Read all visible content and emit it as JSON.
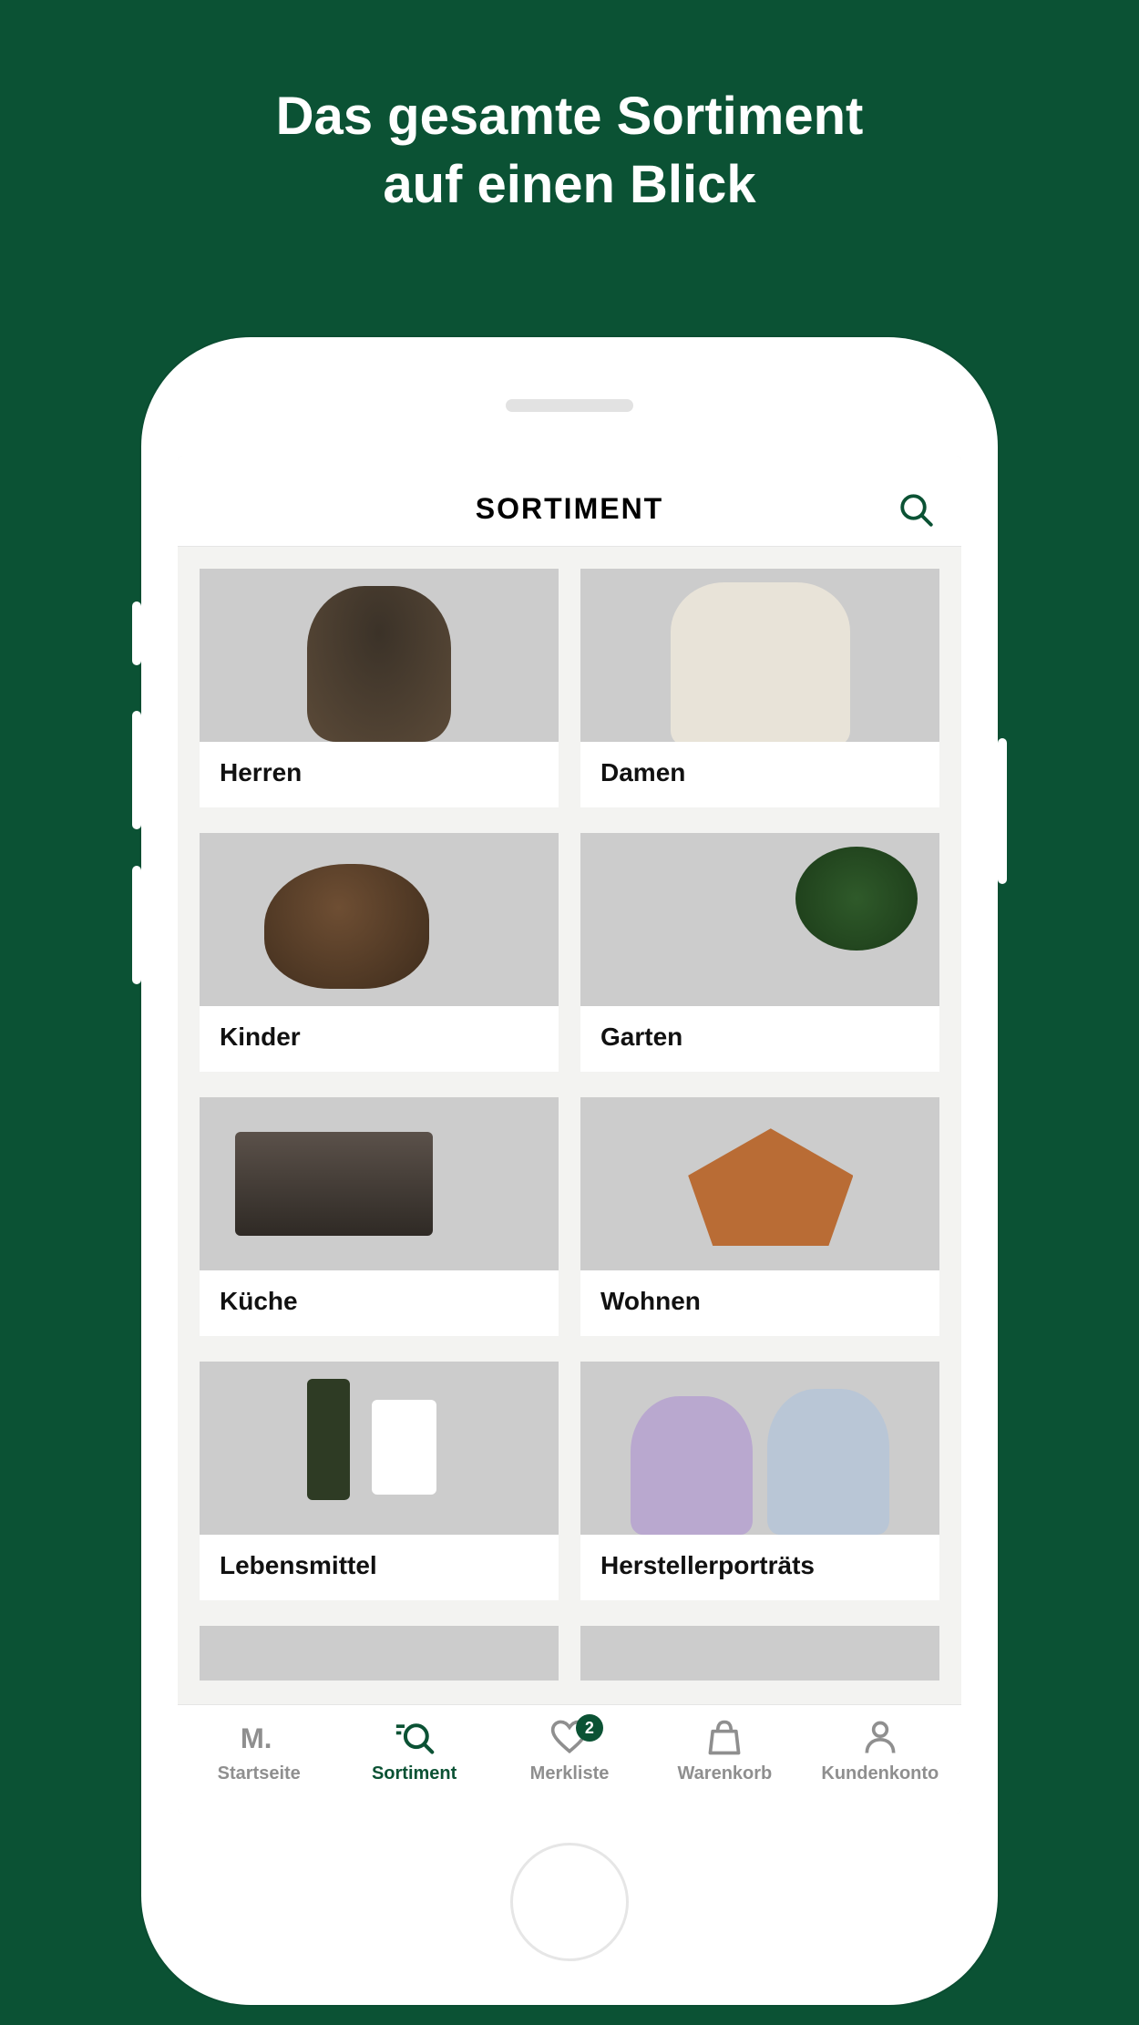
{
  "marketing": {
    "headline_line1": "Das gesamte Sortiment",
    "headline_line2": "auf einen Blick"
  },
  "header": {
    "title": "SORTIMENT"
  },
  "categories": [
    {
      "label": "Herren",
      "thumb_class": "thumb-herren"
    },
    {
      "label": "Damen",
      "thumb_class": "thumb-damen"
    },
    {
      "label": "Kinder",
      "thumb_class": "thumb-kinder"
    },
    {
      "label": "Garten",
      "thumb_class": "thumb-garten"
    },
    {
      "label": "Küche",
      "thumb_class": "thumb-kueche"
    },
    {
      "label": "Wohnen",
      "thumb_class": "thumb-wohnen"
    },
    {
      "label": "Lebensmittel",
      "thumb_class": "thumb-lebensmittel"
    },
    {
      "label": "Herstellerporträts",
      "thumb_class": "thumb-hersteller"
    }
  ],
  "partial_rows": [
    {
      "thumb_class": "thumb-extra1"
    },
    {
      "thumb_class": "thumb-extra2"
    }
  ],
  "tabs": [
    {
      "id": "startseite",
      "label": "Startseite",
      "icon": "logo",
      "active": false,
      "badge": null
    },
    {
      "id": "sortiment",
      "label": "Sortiment",
      "icon": "search",
      "active": true,
      "badge": null
    },
    {
      "id": "merkliste",
      "label": "Merkliste",
      "icon": "heart",
      "active": false,
      "badge": 2
    },
    {
      "id": "warenkorb",
      "label": "Warenkorb",
      "icon": "bag",
      "active": false,
      "badge": null
    },
    {
      "id": "kundenkonto",
      "label": "Kundenkonto",
      "icon": "person",
      "active": false,
      "badge": null
    }
  ],
  "colors": {
    "brand_green": "#0b5234",
    "text_muted": "#8f8f8f"
  }
}
